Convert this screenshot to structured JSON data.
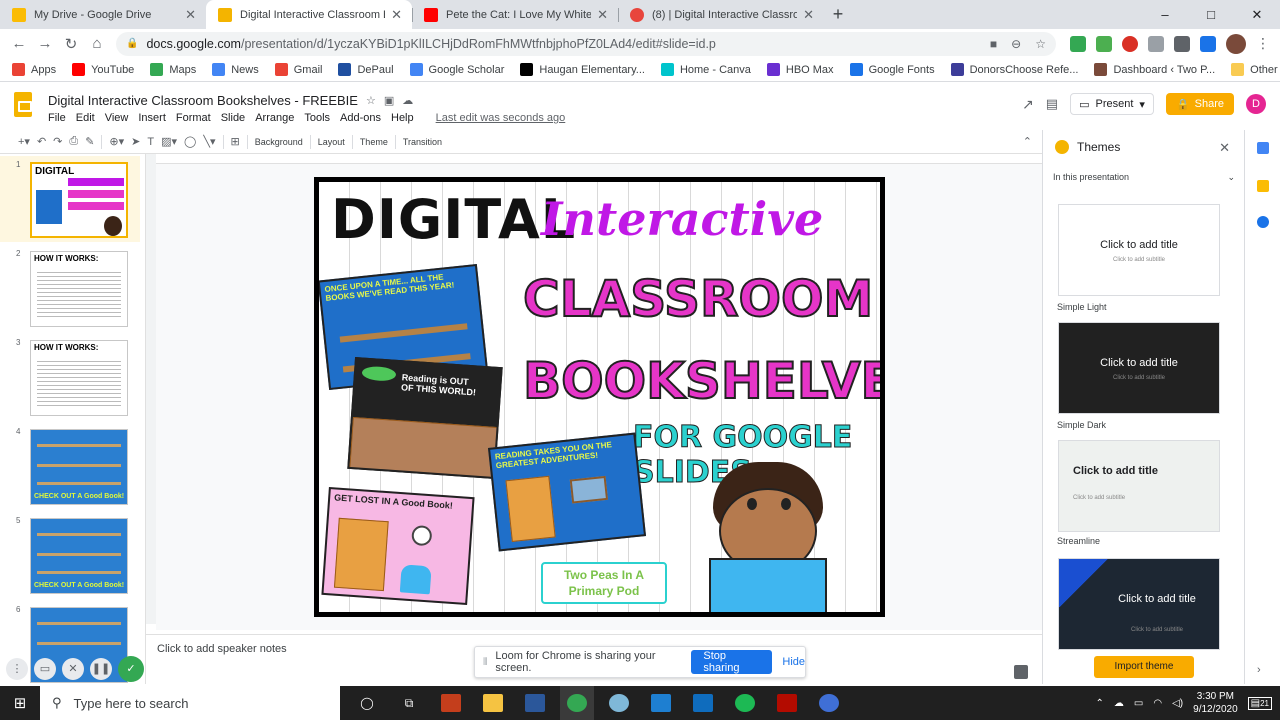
{
  "tabs": [
    {
      "title": "My Drive - Google Drive",
      "color": "#fbbc04"
    },
    {
      "title": "Digital Interactive Classroom Boo",
      "color": "#f4b400",
      "active": true
    },
    {
      "title": "Pete the Cat: I Love My White Sh",
      "color": "#ff0000"
    },
    {
      "title": "(8) | Digital Interactive Classroom",
      "color": "#e8453c"
    }
  ],
  "window_controls": {
    "minimize": "–",
    "maximize": "□",
    "close": "✕"
  },
  "address": {
    "host": "docs.google.com",
    "path": "/presentation/d/1yczaKYBiD1pKlILCHjDdRomFhMWtfnbjphoPfZ0LAd4/edit#slide=id.p"
  },
  "bookmarks": [
    {
      "label": "Apps",
      "color": "#ea4335"
    },
    {
      "label": "YouTube",
      "color": "#ff0000"
    },
    {
      "label": "Maps",
      "color": "#34a853"
    },
    {
      "label": "News",
      "color": "#4285f4"
    },
    {
      "label": "Gmail",
      "color": "#ea4335"
    },
    {
      "label": "DePaul",
      "color": "#1f4fa0"
    },
    {
      "label": "Google Scholar",
      "color": "#4285f4"
    },
    {
      "label": "Haugan Elementary...",
      "color": "#000000"
    },
    {
      "label": "Home - Canva",
      "color": "#00c4cc"
    },
    {
      "label": "HBO Max",
      "color": "#6a2fd1"
    },
    {
      "label": "Google Fonts",
      "color": "#1a73e8"
    },
    {
      "label": "DonorsChoose Refe...",
      "color": "#3d3d99"
    },
    {
      "label": "Dashboard ‹ Two P...",
      "color": "#7a4a3a"
    }
  ],
  "other_bookmarks": "Other bookmarks",
  "doc": {
    "title": "Digital Interactive Classroom Bookshelves - FREEBIE",
    "menus": [
      "File",
      "Edit",
      "View",
      "Insert",
      "Format",
      "Slide",
      "Arrange",
      "Tools",
      "Add-ons",
      "Help"
    ],
    "last_edit": "Last edit was seconds ago",
    "present": "Present",
    "share": "Share",
    "user_initial": "D"
  },
  "toolbar": {
    "background": "Background",
    "layout": "Layout",
    "theme": "Theme",
    "transition": "Transition"
  },
  "filmstrip": [
    {
      "num": "1",
      "title": "DIGITAL"
    },
    {
      "num": "2",
      "title": "HOW IT WORKS:"
    },
    {
      "num": "3",
      "title": "HOW IT WORKS:"
    },
    {
      "num": "4",
      "title": "CHECK OUT A Good Book!"
    },
    {
      "num": "5",
      "title": "CHECK OUT A Good Book!"
    },
    {
      "num": "6",
      "title": ""
    }
  ],
  "slide": {
    "digital": "DIGITAL",
    "interactive": "Interactive",
    "classroom": "CLASSROOM",
    "bookshelves": "BOOKSHELVES",
    "google_slides": "FOR GOOGLE SLIDES",
    "card1": "ONCE UPON A TIME... ALL THE BOOKS WE'VE READ THIS YEAR!",
    "card2": "Reading is OUT OF THIS WORLD!",
    "card3": "READING TAKES YOU ON THE GREATEST ADVENTURES!",
    "card4": "GET LOST IN A Good Book!",
    "logo_line1": "Two Peas In A",
    "logo_line2": "Primary Pod"
  },
  "notes_placeholder": "Click to add speaker notes",
  "loom": {
    "message": "Loom for Chrome is sharing your screen.",
    "stop": "Stop sharing",
    "hide": "Hide"
  },
  "themes_panel": {
    "title": "Themes",
    "in_presentation": "In this presentation",
    "themes": [
      {
        "name": "Simple Light",
        "title": "Click to add title",
        "subtitle": "Click to add subtitle",
        "bg": "#ffffff",
        "fg": "#202124"
      },
      {
        "name": "Simple Dark",
        "title": "Click to add title",
        "subtitle": "Click to add subtitle",
        "bg": "#212121",
        "fg": "#ffffff"
      },
      {
        "name": "Streamline",
        "title": "Click to add title",
        "subtitle": "Click to add subtitle",
        "bg": "#eef1ef",
        "fg": "#202124"
      },
      {
        "name": "",
        "title": "Click to add title",
        "subtitle": "Click to add subtitle",
        "bg": "#1d2733",
        "fg": "#ffffff"
      }
    ],
    "import": "Import theme"
  },
  "taskbar": {
    "search_placeholder": "Type here to search",
    "time": "3:30 PM",
    "date": "9/12/2020",
    "notifications": "21"
  }
}
